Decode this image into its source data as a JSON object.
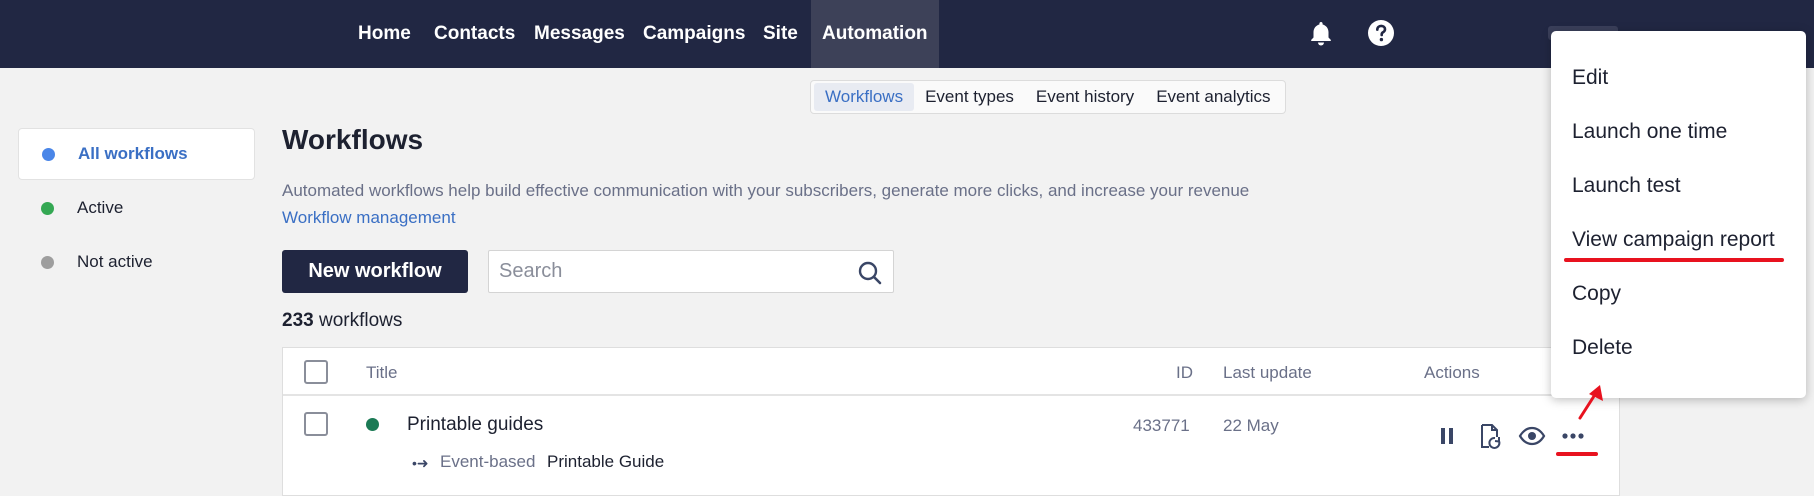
{
  "topnav": {
    "items": [
      {
        "label": "Home",
        "active": false
      },
      {
        "label": "Contacts",
        "active": false
      },
      {
        "label": "Messages",
        "active": false
      },
      {
        "label": "Campaigns",
        "active": false
      },
      {
        "label": "Site",
        "active": false
      },
      {
        "label": "Automation",
        "active": true
      }
    ],
    "icons": [
      "bell-icon",
      "help-icon"
    ]
  },
  "subtabs": [
    {
      "label": "Workflows",
      "active": true
    },
    {
      "label": "Event types",
      "active": false
    },
    {
      "label": "Event history",
      "active": false
    },
    {
      "label": "Event analytics",
      "active": false
    }
  ],
  "sidebar": {
    "filters": [
      {
        "label": "All workflows",
        "color": "#4a86e8",
        "active": true
      },
      {
        "label": "Active",
        "color": "#34a853",
        "active": false
      },
      {
        "label": "Not active",
        "color": "#9e9e9e",
        "active": false
      }
    ]
  },
  "main": {
    "title": "Workflows",
    "description": "Automated workflows help build effective communication with your subscribers, generate more clicks, and increase your revenue",
    "management_link": "Workflow management",
    "new_button": "New workflow",
    "search_placeholder": "Search",
    "count": {
      "number": "233",
      "label": "workflows"
    }
  },
  "table": {
    "columns": {
      "title": "Title",
      "id": "ID",
      "last_update": "Last update",
      "actions": "Actions"
    },
    "rows": [
      {
        "title": "Printable guides",
        "status": "active",
        "status_color": "#1b7a55",
        "type": "Event-based",
        "trigger": "Printable Guide",
        "id": "433771",
        "last_update": "22 May",
        "actions": [
          "pause-icon",
          "restart-doc-icon",
          "eye-icon",
          "more-icon"
        ]
      }
    ]
  },
  "context_menu": {
    "items": [
      "Edit",
      "Launch one time",
      "Launch test",
      "View campaign report",
      "Copy",
      "Delete"
    ],
    "highlighted": "View campaign report"
  },
  "colors": {
    "navbar": "#212743",
    "accent": "#3a6fc4",
    "annotation": "#e8121f"
  }
}
